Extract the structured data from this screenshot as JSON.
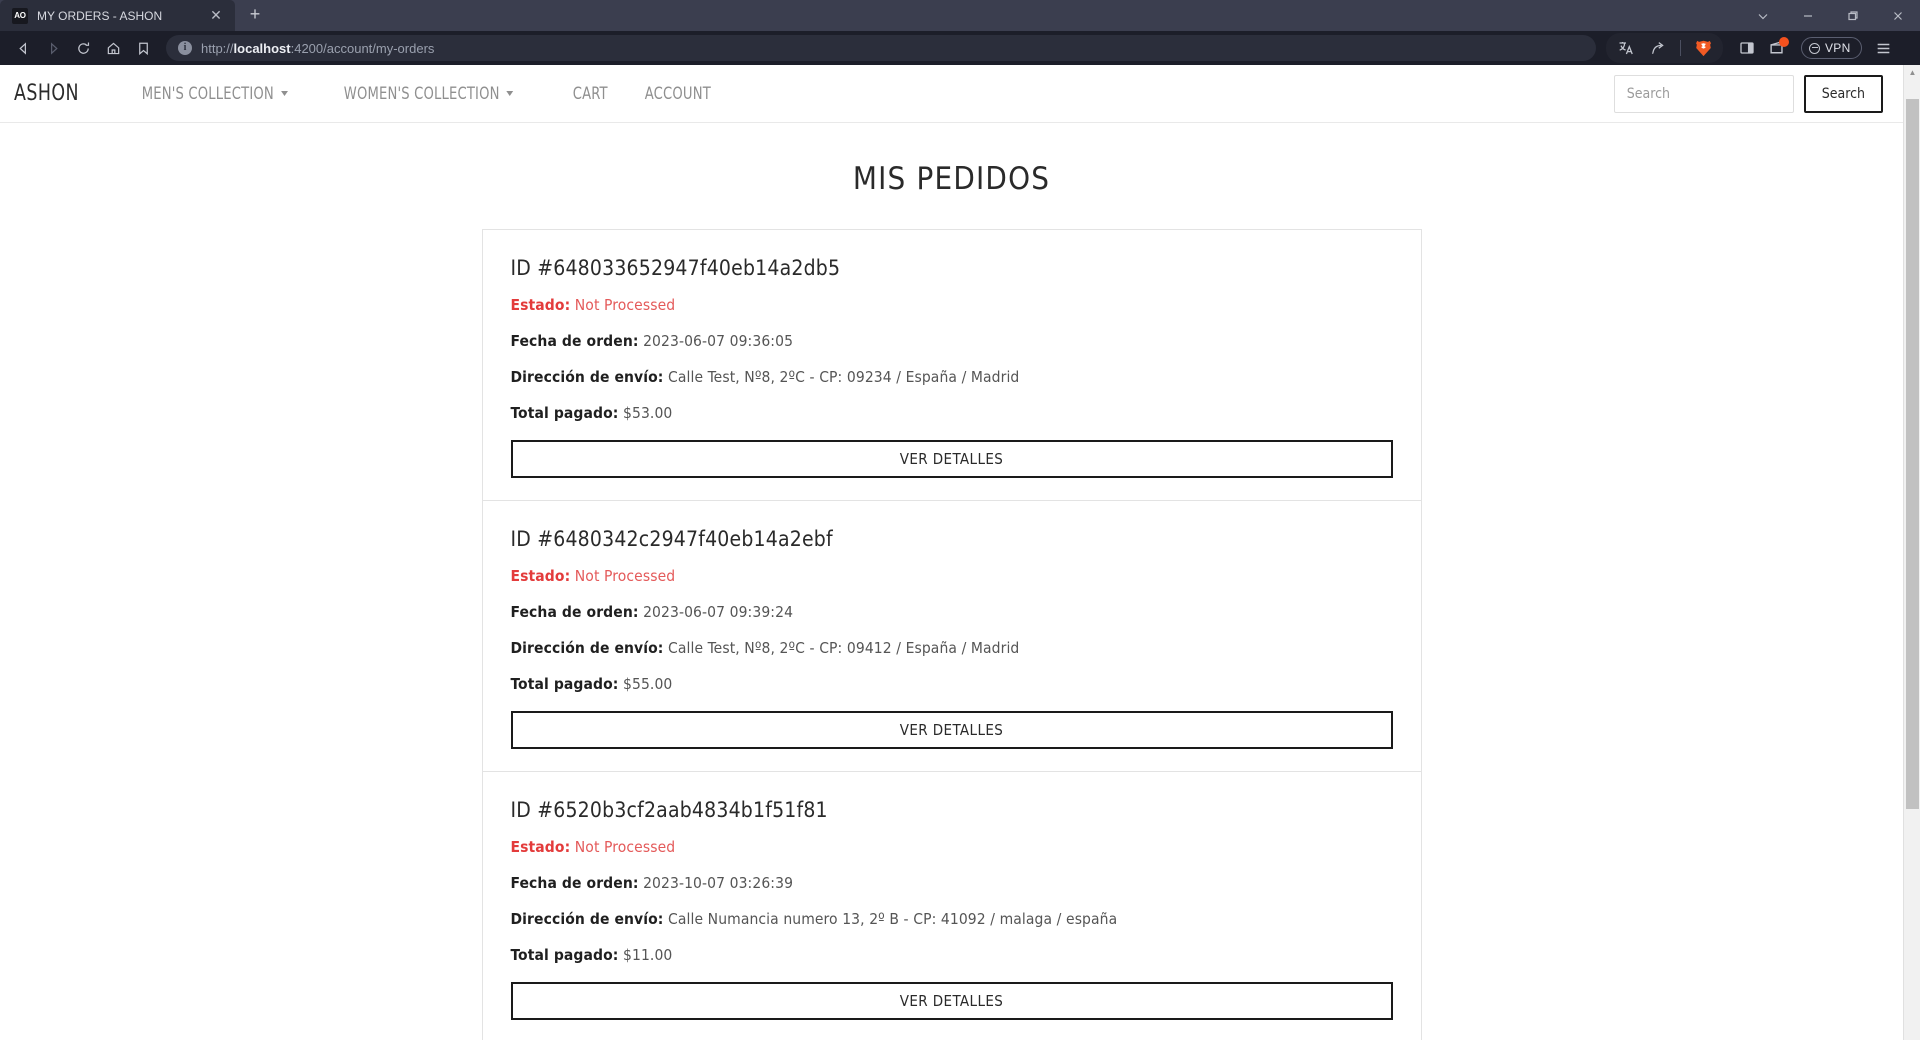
{
  "browser": {
    "tab": {
      "favicon_label": "AO",
      "title": "MY ORDERS - ASHON",
      "close_icon": "close-icon"
    },
    "new_tab_label": "+",
    "window_controls": [
      "chevron-down-icon",
      "minimize-icon",
      "restore-icon",
      "close-icon"
    ],
    "nav_icons": [
      "back-icon",
      "forward-icon",
      "reload-icon",
      "home-icon",
      "bookmark-icon"
    ],
    "url": {
      "scheme": "http://",
      "host": "localhost",
      "rest": ":4200/account/my-orders",
      "full": "http://localhost:4200/account/my-orders",
      "site_info_icon": "info-icon"
    },
    "toolbar_right": {
      "translate_icon": "translate-icon",
      "share_icon": "share-icon",
      "brave_shields_icon": "brave-lion-icon",
      "sidebar_icon": "sidebar-panel-icon",
      "wallet_icon": "wallet-icon",
      "vpn_label": "VPN",
      "menu_icon": "hamburger-menu-icon"
    },
    "colors": {
      "tabstrip_bg": "#3b3e4f",
      "active_tab_bg": "#2b2e3b",
      "toolbar_bg": "#1c1e29",
      "urlbar_bg": "#2b2e3b",
      "badge": "#f4511e"
    }
  },
  "site": {
    "brand": "ASHON",
    "nav_links": [
      {
        "label": "MEN'S COLLECTION",
        "has_caret": true
      },
      {
        "label": "WOMEN'S COLLECTION",
        "has_caret": true
      },
      {
        "label": "CART",
        "has_caret": false
      },
      {
        "label": "ACCOUNT",
        "has_caret": false
      }
    ],
    "search": {
      "placeholder": "Search",
      "value": "",
      "button_label": "Search"
    }
  },
  "main": {
    "title": "MIS PEDIDOS",
    "labels": {
      "status": "Estado:",
      "order_date": "Fecha de orden:",
      "shipping_address": "Dirección de envío:",
      "total_paid": "Total pagado:",
      "details_button": "VER DETALLES",
      "id_prefix": "ID #"
    },
    "status_color": "#e33b3b",
    "orders": [
      {
        "id": "648033652947f40eb14a2db5",
        "id_display": "ID #648033652947f40eb14a2db5",
        "status": "Not Processed",
        "order_date": "2023-06-07 09:36:05",
        "shipping_address": "Calle Test, Nº8, 2ºC - CP: 09234 / España / Madrid",
        "total_paid": "$53.00",
        "details_button": "VER DETALLES"
      },
      {
        "id": "6480342c2947f40eb14a2ebf",
        "id_display": "ID #6480342c2947f40eb14a2ebf",
        "status": "Not Processed",
        "order_date": "2023-06-07 09:39:24",
        "shipping_address": "Calle Test, Nº8, 2ºC - CP: 09412 / España / Madrid",
        "total_paid": "$55.00",
        "details_button": "VER DETALLES"
      },
      {
        "id": "6520b3cf2aab4834b1f51f81",
        "id_display": "ID #6520b3cf2aab4834b1f51f81",
        "status": "Not Processed",
        "order_date": "2023-10-07 03:26:39",
        "shipping_address": "Calle Numancia numero 13, 2º B - CP: 41092 / malaga / españa",
        "total_paid": "$11.00",
        "details_button": "VER DETALLES"
      }
    ]
  }
}
